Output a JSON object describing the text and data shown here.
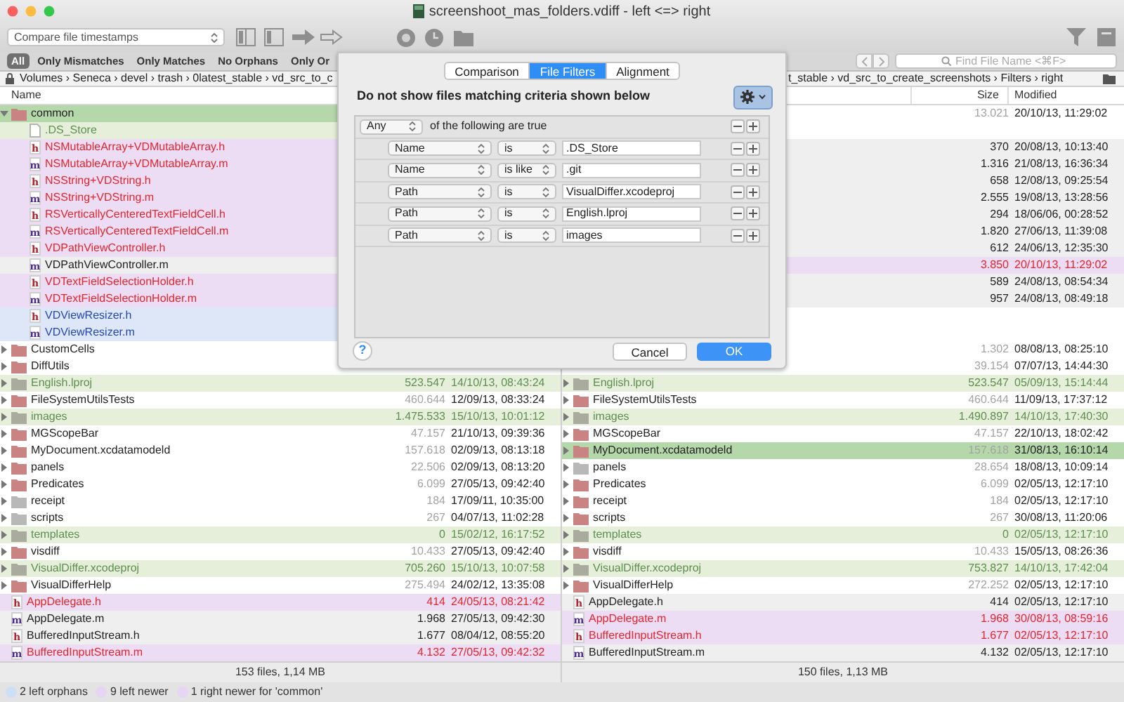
{
  "window": {
    "title": "screenshoot_mas_folders.vdiff - left <=> right"
  },
  "toolbar": {
    "compare_mode": "Compare file timestamps"
  },
  "scope_bar": {
    "items": [
      {
        "label": "All",
        "selected": true
      },
      {
        "label": "Only Mismatches",
        "selected": false
      },
      {
        "label": "Only Matches",
        "selected": false
      },
      {
        "label": "No Orphans",
        "selected": false
      },
      {
        "label": "Only Or",
        "selected": false
      }
    ],
    "search": {
      "placeholder": "Find File Name <⌘F>"
    }
  },
  "path_bar": {
    "left": "Volumes › Seneca › devel › trash › 0latest_stable › vd_src_to_c",
    "right": "t_stable › vd_src_to_create_screenshots › Filters › right"
  },
  "columns": {
    "left": {
      "name": "Name"
    },
    "right": {
      "size": "Size",
      "modified": "Modified"
    }
  },
  "rows": [
    {
      "expanded": true,
      "left": {
        "color": "#c98383",
        "name": "common",
        "kind": "folder",
        "selected": true
      },
      "right": {
        "size": "13.021",
        "modified": "20/10/13, 11:29:02",
        "kind": "folder",
        "selected": false
      },
      "children": [
        {
          "left": {
            "name": ".DS_Store",
            "kind": "filtered",
            "selected": false
          },
          "right": {
            "kind": "empty",
            "selected": false
          }
        },
        {
          "left": {
            "color": "#b3202b",
            "badge": "h",
            "name": "NSMutableArray+VDMutableArray.h",
            "kind": "mismatch",
            "selected": false
          },
          "right": {
            "size": "370",
            "modified": "20/08/13, 10:13:40",
            "kind": "same",
            "selected": false
          }
        },
        {
          "left": {
            "color": "#4b2a87",
            "badge": "m",
            "name": "NSMutableArray+VDMutableArray.m",
            "kind": "mismatch",
            "selected": false
          },
          "right": {
            "size": "1.316",
            "modified": "21/08/13, 16:36:34",
            "kind": "same",
            "selected": false
          }
        },
        {
          "left": {
            "color": "#b3202b",
            "badge": "h",
            "name": "NSString+VDString.h",
            "kind": "mismatch",
            "selected": false
          },
          "right": {
            "size": "658",
            "modified": "12/08/13, 09:25:54",
            "kind": "same",
            "selected": false
          }
        },
        {
          "left": {
            "color": "#4b2a87",
            "badge": "m",
            "name": "NSString+VDString.m",
            "kind": "mismatch",
            "selected": false
          },
          "right": {
            "size": "2.555",
            "modified": "19/08/13, 13:28:56",
            "kind": "same",
            "selected": false
          }
        },
        {
          "left": {
            "color": "#b3202b",
            "badge": "h",
            "name": "RSVerticallyCenteredTextFieldCell.h",
            "kind": "mismatch",
            "selected": false
          },
          "right": {
            "size": "294",
            "modified": "18/06/06, 00:28:52",
            "kind": "same",
            "selected": false
          }
        },
        {
          "left": {
            "color": "#4b2a87",
            "badge": "m",
            "name": "RSVerticallyCenteredTextFieldCell.m",
            "kind": "mismatch",
            "selected": false
          },
          "right": {
            "size": "1.820",
            "modified": "27/06/13, 11:39:08",
            "kind": "same",
            "selected": false
          }
        },
        {
          "left": {
            "color": "#b3202b",
            "badge": "h",
            "name": "VDPathViewController.h",
            "kind": "mismatch",
            "selected": false
          },
          "right": {
            "size": "612",
            "modified": "24/06/13, 12:35:30",
            "kind": "same",
            "selected": false
          }
        },
        {
          "left": {
            "color": "#4b2a87",
            "badge": "m",
            "name": "VDPathViewController.m",
            "kind": "same",
            "selected": false
          },
          "right": {
            "size": "3.850",
            "modified": "20/10/13, 11:29:02",
            "kind": "mismatch",
            "selected": false
          }
        },
        {
          "left": {
            "color": "#b3202b",
            "badge": "h",
            "name": "VDTextFieldSelectionHolder.h",
            "kind": "mismatch",
            "selected": false
          },
          "right": {
            "size": "589",
            "modified": "24/08/13, 08:54:34",
            "kind": "same",
            "selected": false
          }
        },
        {
          "left": {
            "color": "#4b2a87",
            "badge": "m",
            "name": "VDTextFieldSelectionHolder.m",
            "kind": "mismatch",
            "selected": false
          },
          "right": {
            "size": "957",
            "modified": "24/08/13, 08:49:18",
            "kind": "same",
            "selected": false
          }
        },
        {
          "left": {
            "color": "#b3202b",
            "badge": "h",
            "name": "VDViewResizer.h",
            "kind": "orphan",
            "selected": false
          },
          "right": {
            "kind": "empty",
            "selected": false
          }
        },
        {
          "left": {
            "color": "#4b2a87",
            "badge": "m",
            "name": "VDViewResizer.m",
            "kind": "orphan",
            "selected": false
          },
          "right": {
            "kind": "empty",
            "selected": false
          }
        }
      ]
    },
    {
      "expanded": false,
      "left": {
        "color": "#c98383",
        "name": "CustomCells",
        "kind": "folder",
        "selected": false
      },
      "right": {
        "size": "1.302",
        "modified": "08/08/13, 08:25:10",
        "kind": "folder",
        "selected": false
      }
    },
    {
      "expanded": false,
      "left": {
        "color": "#c98383",
        "name": "DiffUtils",
        "kind": "folder",
        "selected": false
      },
      "right": {
        "size": "39.154",
        "modified": "07/07/13, 14:44:30",
        "kind": "folder",
        "selected": false
      }
    },
    {
      "expanded": false,
      "left": {
        "color": "#a9ab9f",
        "name": "English.lproj",
        "size": "523.547",
        "modified": "14/10/13, 08:43:24",
        "kind": "filtered",
        "selected": false
      },
      "right": {
        "color": "#a9ab9f",
        "name": "English.lproj",
        "size": "523.547",
        "modified": "05/09/13, 15:14:44",
        "kind": "filtered",
        "selected": false
      }
    },
    {
      "expanded": false,
      "left": {
        "color": "#c98383",
        "name": "FileSystemUtilsTests",
        "size": "460.644",
        "modified": "12/09/13, 08:33:24",
        "kind": "folder",
        "selected": false
      },
      "right": {
        "color": "#c98383",
        "name": "FileSystemUtilsTests",
        "size": "460.644",
        "modified": "11/09/13, 17:37:12",
        "kind": "folder",
        "selected": false
      }
    },
    {
      "expanded": false,
      "left": {
        "color": "#a9ab9f",
        "name": "images",
        "size": "1.475.533",
        "modified": "15/10/13, 10:01:12",
        "kind": "filtered",
        "selected": false
      },
      "right": {
        "color": "#a9ab9f",
        "name": "images",
        "size": "1.490.897",
        "modified": "14/10/13, 17:40:30",
        "kind": "filtered",
        "selected": false
      }
    },
    {
      "expanded": false,
      "left": {
        "color": "#c98383",
        "name": "MGScopeBar",
        "size": "47.157",
        "modified": "21/10/13, 09:39:36",
        "kind": "folder",
        "selected": false
      },
      "right": {
        "color": "#c98383",
        "name": "MGScopeBar",
        "size": "47.157",
        "modified": "22/10/13, 18:02:42",
        "kind": "folder",
        "selected": false
      }
    },
    {
      "expanded": false,
      "left": {
        "color": "#c98383",
        "name": "MyDocument.xcdatamodeld",
        "size": "157.618",
        "modified": "02/09/13, 08:13:18",
        "kind": "folder",
        "selected": false
      },
      "right": {
        "color": "#c98383",
        "name": "MyDocument.xcdatamodeld",
        "size": "157.618",
        "modified": "31/08/13, 16:10:14",
        "kind": "folder",
        "selected": true
      }
    },
    {
      "expanded": false,
      "left": {
        "color": "#c98383",
        "name": "panels",
        "size": "22.506",
        "modified": "02/09/13, 08:13:20",
        "kind": "folder",
        "selected": false
      },
      "right": {
        "color": "#b8b8b8",
        "name": "panels",
        "size": "28.654",
        "modified": "18/08/13, 10:09:14",
        "kind": "folder",
        "selected": false
      }
    },
    {
      "expanded": false,
      "left": {
        "color": "#c98383",
        "name": "Predicates",
        "size": "6.099",
        "modified": "27/05/13, 09:42:40",
        "kind": "folder",
        "selected": false
      },
      "right": {
        "color": "#c98383",
        "name": "Predicates",
        "size": "6.099",
        "modified": "02/05/13, 12:17:10",
        "kind": "folder",
        "selected": false
      }
    },
    {
      "expanded": false,
      "left": {
        "color": "#b8b8b8",
        "name": "receipt",
        "size": "184",
        "modified": "17/09/11, 10:35:00",
        "kind": "folder",
        "selected": false
      },
      "right": {
        "color": "#c98383",
        "name": "receipt",
        "size": "184",
        "modified": "02/05/13, 12:17:10",
        "kind": "folder",
        "selected": false
      }
    },
    {
      "expanded": false,
      "left": {
        "color": "#b8b8b8",
        "name": "scripts",
        "size": "267",
        "modified": "04/07/13, 11:02:28",
        "kind": "folder",
        "selected": false
      },
      "right": {
        "color": "#c98383",
        "name": "scripts",
        "size": "267",
        "modified": "30/08/13, 11:20:06",
        "kind": "folder",
        "selected": false
      }
    },
    {
      "expanded": false,
      "left": {
        "color": "#a9ab9f",
        "name": "templates",
        "size": "0",
        "modified": "15/02/12, 16:17:52",
        "kind": "filtered",
        "selected": false
      },
      "right": {
        "color": "#a9ab9f",
        "name": "templates",
        "size": "0",
        "modified": "02/05/13, 12:17:10",
        "kind": "filtered",
        "selected": false
      }
    },
    {
      "expanded": false,
      "left": {
        "color": "#c98383",
        "name": "visdiff",
        "size": "10.433",
        "modified": "27/05/13, 09:42:40",
        "kind": "folder",
        "selected": false
      },
      "right": {
        "color": "#c98383",
        "name": "visdiff",
        "size": "10.433",
        "modified": "15/05/13, 08:26:36",
        "kind": "folder",
        "selected": false
      }
    },
    {
      "expanded": false,
      "left": {
        "color": "#a9ab9f",
        "name": "VisualDiffer.xcodeproj",
        "size": "705.260",
        "modified": "15/10/13, 10:07:58",
        "kind": "filtered",
        "selected": false
      },
      "right": {
        "color": "#a9ab9f",
        "name": "VisualDiffer.xcodeproj",
        "size": "753.827",
        "modified": "14/10/13, 17:42:04",
        "kind": "filtered",
        "selected": false
      }
    },
    {
      "expanded": false,
      "left": {
        "color": "#c98383",
        "name": "VisualDifferHelp",
        "size": "275.494",
        "modified": "24/02/12, 13:35:08",
        "kind": "folder",
        "selected": false
      },
      "right": {
        "color": "#c98383",
        "name": "VisualDifferHelp",
        "size": "272.252",
        "modified": "02/05/13, 12:17:10",
        "kind": "folder",
        "selected": false
      }
    },
    {
      "left": {
        "color": "#b3202b",
        "badge": "h",
        "name": "AppDelegate.h",
        "size": "414",
        "modified": "24/05/13, 08:21:42",
        "kind": "mismatch",
        "selected": false
      },
      "right": {
        "color": "#b3202b",
        "badge": "h",
        "name": "AppDelegate.h",
        "size": "414",
        "modified": "02/05/13, 12:17:10",
        "kind": "same",
        "selected": false
      }
    },
    {
      "left": {
        "color": "#4b2a87",
        "badge": "m",
        "name": "AppDelegate.m",
        "size": "1.968",
        "modified": "27/05/13, 09:42:30",
        "kind": "same",
        "selected": false
      },
      "right": {
        "color": "#4b2a87",
        "badge": "m",
        "name": "AppDelegate.m",
        "size": "1.968",
        "modified": "30/08/13, 08:59:16",
        "kind": "mismatch",
        "selected": false
      }
    },
    {
      "left": {
        "color": "#b3202b",
        "badge": "h",
        "name": "BufferedInputStream.h",
        "size": "1.677",
        "modified": "08/04/12, 08:55:20",
        "kind": "same",
        "selected": false
      },
      "right": {
        "color": "#b3202b",
        "badge": "h",
        "name": "BufferedInputStream.h",
        "size": "1.677",
        "modified": "02/05/13, 12:17:10",
        "kind": "mismatch",
        "selected": false
      }
    },
    {
      "left": {
        "color": "#4b2a87",
        "badge": "m",
        "name": "BufferedInputStream.m",
        "size": "4.132",
        "modified": "27/05/13, 09:42:32",
        "kind": "mismatch",
        "selected": false
      },
      "right": {
        "color": "#4b2a87",
        "badge": "m",
        "name": "BufferedInputStream.m",
        "size": "4.132",
        "modified": "02/05/13, 12:17:10",
        "kind": "same",
        "selected": false
      }
    }
  ],
  "footer": {
    "left": "153 files, 1,14 MB",
    "right": "150 files, 1,13 MB"
  },
  "legend": [
    {
      "label": "2 left orphans",
      "color": "#cddff5"
    },
    {
      "label": "9 left newer",
      "color": "#e7d5f4"
    },
    {
      "label": "1 right newer for 'common'",
      "color": "#e7d5f4"
    }
  ],
  "dialog": {
    "tabs": [
      {
        "label": "Comparison",
        "selected": false
      },
      {
        "label": "File Filters",
        "selected": true
      },
      {
        "label": "Alignment",
        "selected": false
      }
    ],
    "heading": "Do not show files matching criteria shown below",
    "match": {
      "quantifier": "Any",
      "text": "of the following are true"
    },
    "criteria": [
      {
        "field": "Name",
        "operator": "is",
        "value": ".DS_Store"
      },
      {
        "field": "Name",
        "operator": "is like",
        "value": ".git"
      },
      {
        "field": "Path",
        "operator": "is",
        "value": "VisualDiffer.xcodeproj"
      },
      {
        "field": "Path",
        "operator": "is",
        "value": "English.lproj"
      },
      {
        "field": "Path",
        "operator": "is",
        "value": "images"
      }
    ],
    "help": "?",
    "buttons": [
      {
        "label": "Cancel",
        "default": false
      },
      {
        "label": "OK",
        "default": true
      }
    ]
  }
}
